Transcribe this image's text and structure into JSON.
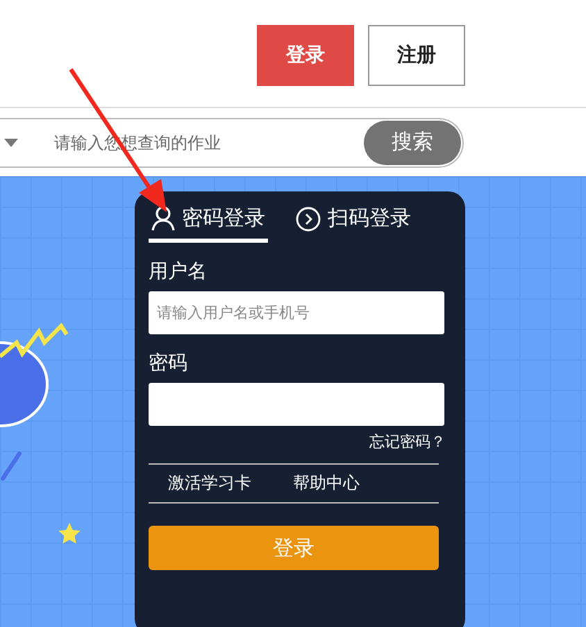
{
  "header": {
    "buttons": [
      {
        "label": "登录",
        "kind": "primary"
      },
      {
        "label": "注册",
        "kind": "outline"
      }
    ]
  },
  "search": {
    "placeholder": "请输入您想查询的作业",
    "button": "搜索"
  },
  "login_panel": {
    "tabs": [
      {
        "label": "密码登录",
        "selected": true,
        "kind": "password"
      },
      {
        "label": "扫码登录",
        "selected": false,
        "kind": "qrcode"
      }
    ],
    "username_label": "用户名",
    "username_placeholder": "请输入用户名或手机号",
    "password_label": "密码",
    "forgot": "忘记密码？",
    "links": [
      "激活学习卡",
      "帮助中心"
    ],
    "submit": "登录"
  }
}
